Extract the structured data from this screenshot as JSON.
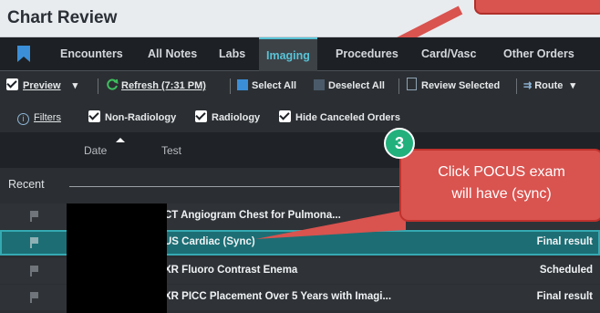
{
  "window": {
    "title": "Chart Review"
  },
  "tabs": [
    {
      "label": "Encounters"
    },
    {
      "label": "All Notes"
    },
    {
      "label": "Labs"
    },
    {
      "label": "Imaging",
      "active": true
    },
    {
      "label": "Procedures"
    },
    {
      "label": "Card/Vasc"
    },
    {
      "label": "Other Orders"
    }
  ],
  "toolbar": {
    "preview_label": "Preview",
    "refresh_label": "Refresh (7:31 PM)",
    "select_all_label": "Select All",
    "deselect_all_label": "Deselect All",
    "review_selected_label": "Review Selected",
    "route_label": "Route"
  },
  "filters": {
    "label": "Filters",
    "non_radiology_label": "Non-Radiology",
    "radiology_label": "Radiology",
    "hide_canceled_label": "Hide Canceled Orders"
  },
  "table": {
    "columns": {
      "date": "Date",
      "test": "Test"
    },
    "section_label": "Recent",
    "rows": [
      {
        "test": "CT Angiogram Chest for Pulmona...",
        "status": ""
      },
      {
        "test": "US Cardiac (Sync)",
        "status": "Final result",
        "selected": true
      },
      {
        "test": "XR Fluoro Contrast Enema",
        "status": "Scheduled"
      },
      {
        "test": "XR PICC Placement Over 5 Years with Imagi...",
        "status": "Final result"
      }
    ]
  },
  "annotation": {
    "step_number": "3",
    "line1": "Click POCUS exam",
    "line2": "will have (sync)"
  },
  "colors": {
    "accent": "#59c3d6",
    "selected_row": "#1c6e74",
    "callout": "#d9534f",
    "badge": "#22b07d"
  }
}
